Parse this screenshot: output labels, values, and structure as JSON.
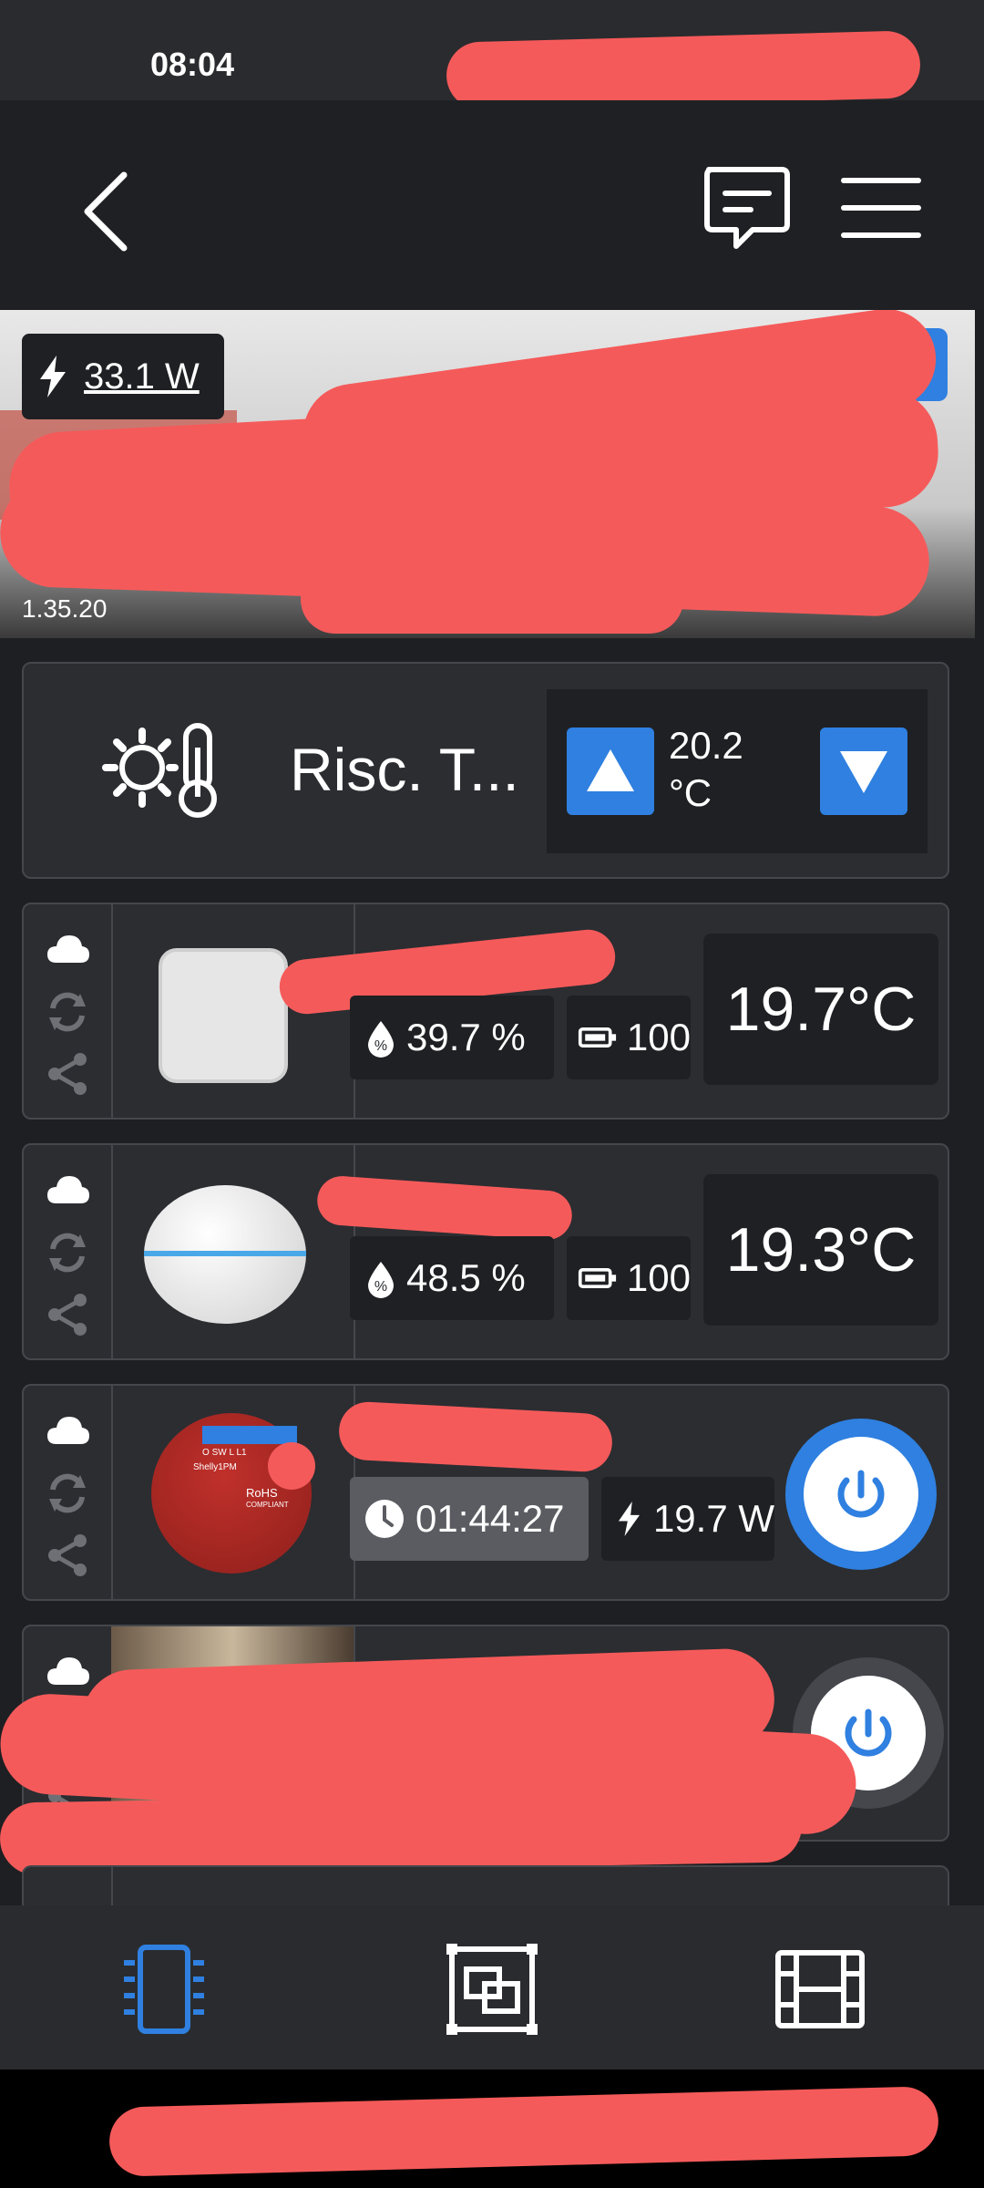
{
  "status_bar": {
    "time": "08:04"
  },
  "banner": {
    "power": "33.1 W",
    "version": "1.35.20"
  },
  "thermostat": {
    "name": "Risc. T...",
    "setpoint": "20.2",
    "unit": "°C"
  },
  "devices": [
    {
      "humidity": "39.7 %",
      "battery": "100",
      "temperature": "19.7°C"
    },
    {
      "humidity": "48.5 %",
      "battery": "100",
      "temperature": "19.3°C"
    },
    {
      "timer": "01:44:27",
      "power": "19.7 W",
      "relay_text": [
        "O",
        "SW",
        "L",
        "L1",
        "Shelly1PM",
        "RoHS",
        "COMPLIANT"
      ]
    }
  ],
  "colors": {
    "accent": "#2f80e0",
    "redaction": "#f55a5a",
    "card_bg": "#2b2d31"
  },
  "bottom_nav": [
    "devices-icon",
    "rooms-icon",
    "scenes-icon"
  ]
}
